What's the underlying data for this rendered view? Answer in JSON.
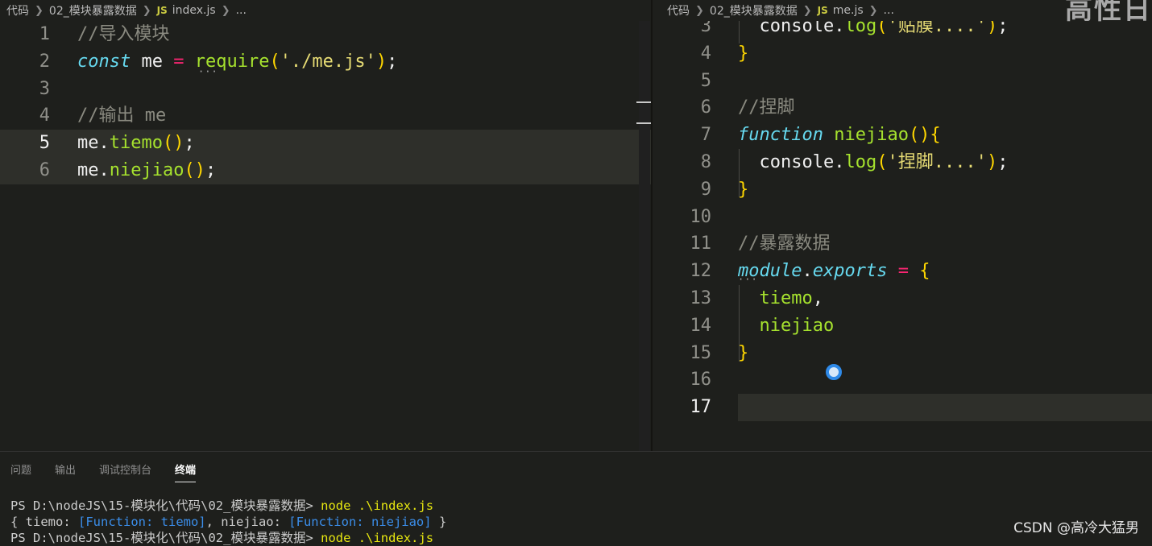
{
  "left_editor": {
    "breadcrumb": [
      "代码",
      "02_模块暴露数据",
      "index.js",
      "..."
    ],
    "file_badge": "JS",
    "lines": [
      {
        "num": "1",
        "tokens": [
          {
            "t": "//导入模块",
            "c": "com"
          }
        ]
      },
      {
        "num": "2",
        "tokens": [
          {
            "t": "const",
            "c": "kw"
          },
          {
            "t": " me ",
            "c": "pl"
          },
          {
            "t": "=",
            "c": "op"
          },
          {
            "t": " ",
            "c": "pl"
          },
          {
            "t": "require",
            "c": "fn"
          },
          {
            "t": "(",
            "c": "br"
          },
          {
            "t": "'./me.js'",
            "c": "str"
          },
          {
            "t": ")",
            "c": "br"
          },
          {
            "t": ";",
            "c": "pl"
          }
        ]
      },
      {
        "num": "3",
        "tokens": []
      },
      {
        "num": "4",
        "tokens": [
          {
            "t": "//输出 me",
            "c": "com"
          }
        ]
      },
      {
        "num": "5",
        "tokens": [
          {
            "t": "me.",
            "c": "pl"
          },
          {
            "t": "tiemo",
            "c": "fn"
          },
          {
            "t": "()",
            "c": "br"
          },
          {
            "t": ";",
            "c": "pl"
          }
        ]
      },
      {
        "num": "6",
        "tokens": [
          {
            "t": "me.",
            "c": "pl"
          },
          {
            "t": "niejiao",
            "c": "fn"
          },
          {
            "t": "()",
            "c": "br"
          },
          {
            "t": ";",
            "c": "pl"
          }
        ]
      }
    ]
  },
  "right_editor": {
    "breadcrumb": [
      "代码",
      "02_模块暴露数据",
      "me.js",
      "..."
    ],
    "file_badge": "JS",
    "lines": [
      {
        "num": "3",
        "tokens": [
          {
            "t": "  console.",
            "c": "pl"
          },
          {
            "t": "log",
            "c": "fn"
          },
          {
            "t": "(",
            "c": "br"
          },
          {
            "t": "'贴膜....'",
            "c": "str"
          },
          {
            "t": ")",
            "c": "br"
          },
          {
            "t": ";",
            "c": "pl"
          }
        ]
      },
      {
        "num": "4",
        "tokens": [
          {
            "t": "}",
            "c": "br"
          }
        ]
      },
      {
        "num": "5",
        "tokens": []
      },
      {
        "num": "6",
        "tokens": [
          {
            "t": "//捏脚",
            "c": "com"
          }
        ]
      },
      {
        "num": "7",
        "tokens": [
          {
            "t": "function",
            "c": "kw"
          },
          {
            "t": " ",
            "c": "pl"
          },
          {
            "t": "niejiao",
            "c": "fn"
          },
          {
            "t": "(){",
            "c": "br"
          }
        ]
      },
      {
        "num": "8",
        "tokens": [
          {
            "t": "  console.",
            "c": "pl"
          },
          {
            "t": "log",
            "c": "fn"
          },
          {
            "t": "(",
            "c": "br"
          },
          {
            "t": "'捏脚....'",
            "c": "str"
          },
          {
            "t": ")",
            "c": "br"
          },
          {
            "t": ";",
            "c": "pl"
          }
        ]
      },
      {
        "num": "9",
        "tokens": [
          {
            "t": "}",
            "c": "br"
          }
        ]
      },
      {
        "num": "10",
        "tokens": []
      },
      {
        "num": "11",
        "tokens": [
          {
            "t": "//暴露数据",
            "c": "com"
          }
        ]
      },
      {
        "num": "12",
        "tokens": [
          {
            "t": "module",
            "c": "kw"
          },
          {
            "t": ".",
            "c": "pl"
          },
          {
            "t": "exports",
            "c": "kw"
          },
          {
            "t": " ",
            "c": "pl"
          },
          {
            "t": "=",
            "c": "op"
          },
          {
            "t": " ",
            "c": "pl"
          },
          {
            "t": "{",
            "c": "br"
          }
        ]
      },
      {
        "num": "13",
        "tokens": [
          {
            "t": "  tiemo",
            "c": "fn"
          },
          {
            "t": ",",
            "c": "pl"
          }
        ]
      },
      {
        "num": "14",
        "tokens": [
          {
            "t": "  niejiao",
            "c": "fn"
          }
        ]
      },
      {
        "num": "15",
        "tokens": [
          {
            "t": "}",
            "c": "br"
          }
        ]
      },
      {
        "num": "16",
        "tokens": []
      },
      {
        "num": "17",
        "tokens": []
      }
    ]
  },
  "panel": {
    "tabs": [
      "问题",
      "输出",
      "调试控制台",
      "终端"
    ],
    "active_tab": "终端",
    "terminal": {
      "prompt1": "PS D:\\nodeJS\\15-模块化\\代码\\02_模块暴露数据> ",
      "cmd1": "node .\\index.js",
      "out_prefix": "{ tiemo: ",
      "out_fn1": "[Function: tiemo]",
      "out_mid": ", niejiao: ",
      "out_fn2": "[Function: niejiao]",
      "out_suffix": " }",
      "prompt2": "PS D:\\nodeJS\\15-模块化\\代码\\02_模块暴露数据> ",
      "cmd2": "node .\\index.js"
    }
  },
  "watermark": "CSDN @高冷大猛男",
  "overlay_top_text": "高性日"
}
